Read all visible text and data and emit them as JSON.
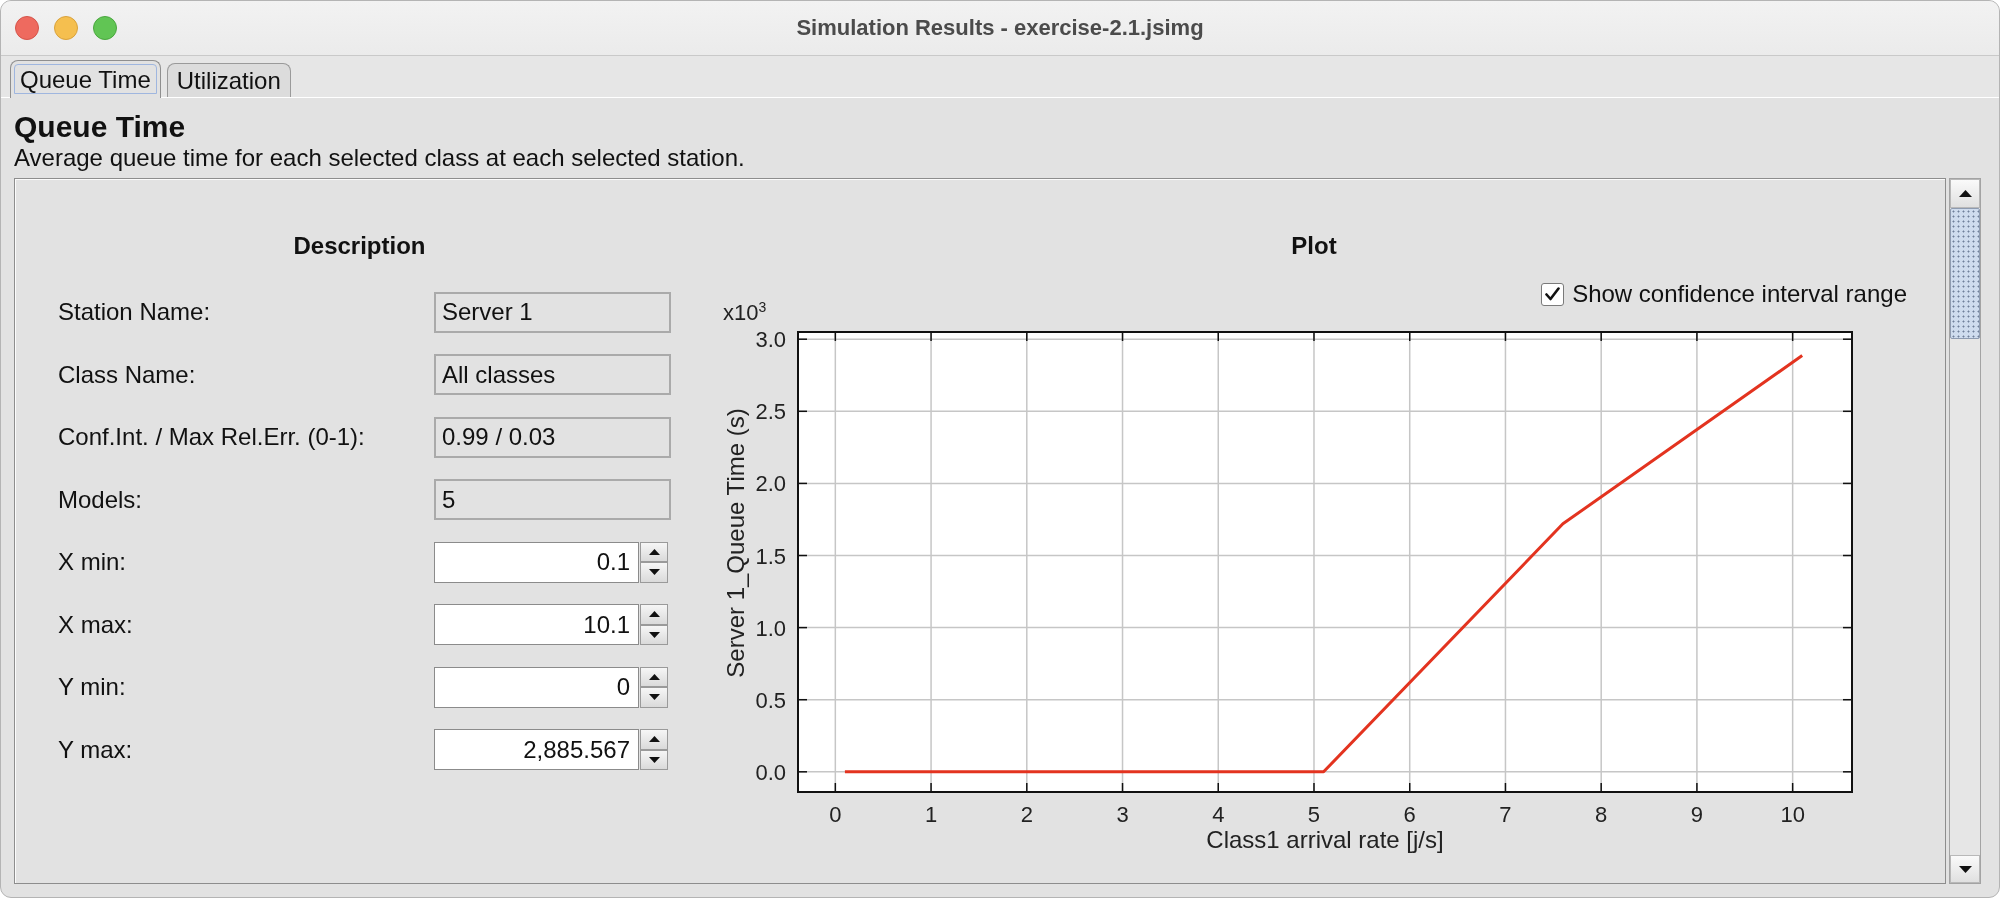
{
  "window": {
    "title": "Simulation Results - exercise-2.1.jsimg"
  },
  "tabs": [
    {
      "label": "Queue Time",
      "selected": true
    },
    {
      "label": "Utilization",
      "selected": false
    }
  ],
  "panel_header": {
    "title": "Queue Time",
    "description": "Average queue time for each selected class at each selected station."
  },
  "description": {
    "heading": "Description",
    "fields": [
      {
        "kind": "readonly",
        "label": "Station Name:",
        "value": "Server 1"
      },
      {
        "kind": "readonly",
        "label": "Class Name:",
        "value": "All classes"
      },
      {
        "kind": "readonly",
        "label": "Conf.Int. / Max Rel.Err. (0-1):",
        "value": "0.99 / 0.03"
      },
      {
        "kind": "readonly",
        "label": "Models:",
        "value": "5"
      },
      {
        "kind": "spinner",
        "label": "X min:",
        "value": "0.1"
      },
      {
        "kind": "spinner",
        "label": "X max:",
        "value": "10.1"
      },
      {
        "kind": "spinner",
        "label": "Y min:",
        "value": "0"
      },
      {
        "kind": "spinner",
        "label": "Y max:",
        "value": "2,885.567"
      }
    ]
  },
  "plot": {
    "heading": "Plot",
    "confidence_range": {
      "label": "Show confidence interval range",
      "checked": true
    },
    "scale_label": "x10$^{3}$",
    "chart_data": {
      "type": "line",
      "xlabel": "Class1 arrival rate [j/s]",
      "ylabel": "Server 1_Queue Time (s)",
      "grid": true,
      "x": [
        0.1,
        2.6,
        5.1,
        7.6,
        10.1
      ],
      "series": [
        {
          "color": "#e3331f",
          "values": [
            0,
            0,
            0,
            1.72,
            2.886
          ]
        }
      ],
      "xlim": [
        -0.39,
        10.62
      ],
      "ylim": [
        -0.14,
        3.05
      ],
      "xticks": [
        0,
        1,
        2,
        3,
        4,
        5,
        6,
        7,
        8,
        9,
        10
      ],
      "yticks": [
        {
          "value": 0,
          "label": "0.0"
        },
        {
          "value": 0.5,
          "label": "0.5"
        },
        {
          "value": 1,
          "label": "1.0"
        },
        {
          "value": 1.5,
          "label": "1.5"
        },
        {
          "value": 2,
          "label": "2.0"
        },
        {
          "value": 2.5,
          "label": "2.5"
        },
        {
          "value": 3,
          "label": "3.0"
        }
      ]
    }
  }
}
